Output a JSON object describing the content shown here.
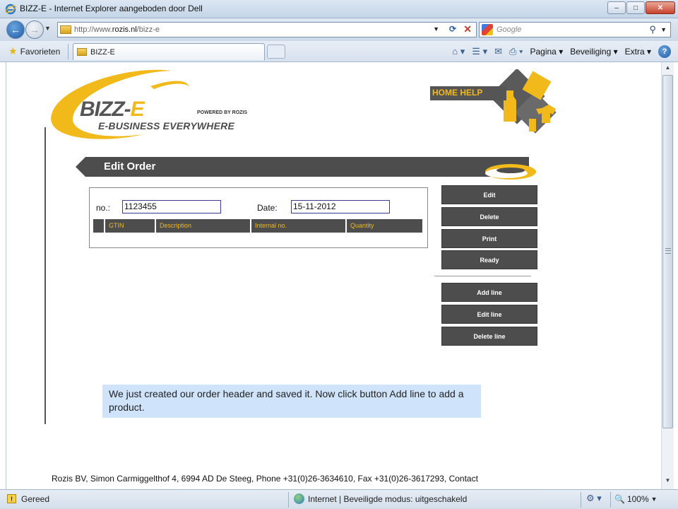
{
  "window": {
    "title": "BIZZ-E - Internet Explorer aangeboden door Dell",
    "controls": {
      "minimize": "–",
      "maximize": "□",
      "close": "✕"
    }
  },
  "navbar": {
    "back": "←",
    "forward": "→",
    "url_prefix": "http://www.",
    "url_domain": "rozis.nl",
    "url_path": "/bizz-e",
    "search_placeholder": "Google"
  },
  "tabbar": {
    "favorites_label": "Favorieten",
    "tab_title": "BIZZ-E",
    "commands": {
      "page": "Pagina",
      "security": "Beveiliging",
      "extra": "Extra",
      "help_glyph": "?"
    }
  },
  "site": {
    "logo_brand_a": "BIZZ-",
    "logo_brand_b": "E",
    "logo_tagline": "E-BUSINESS EVERYWHERE",
    "logo_powered": "POWERED BY ROZIS",
    "home_help": "HOME HELP",
    "page_title": "Edit Order",
    "order": {
      "no_label": "no.:",
      "no_value": "1123455",
      "date_label": "Date:",
      "date_value": "15-11-2012",
      "columns": [
        "GTIN",
        "Description",
        "Internal no.",
        "Quantity"
      ]
    },
    "buttons": {
      "edit": "Edit",
      "delete": "Delete",
      "print": "Print",
      "ready": "Ready",
      "add_line": "Add line",
      "edit_line": "Edit line",
      "delete_line": "Delete line"
    },
    "callout": "We just created our order header and saved it. Now click button Add line to add a product.",
    "footer": "Rozis BV, Simon Carmiggelthof 4, 6994 AD De Steeg, Phone +31(0)26-3634610, Fax +31(0)26-3617293, Contact"
  },
  "statusbar": {
    "status": "Gereed",
    "zone": "Internet | Beveiligde modus: uitgeschakeld",
    "zoom": "100%"
  },
  "colors": {
    "brand_yellow": "#f2b91b",
    "brand_gray": "#4d4d4d",
    "callout_bg": "#cfe3fb"
  }
}
